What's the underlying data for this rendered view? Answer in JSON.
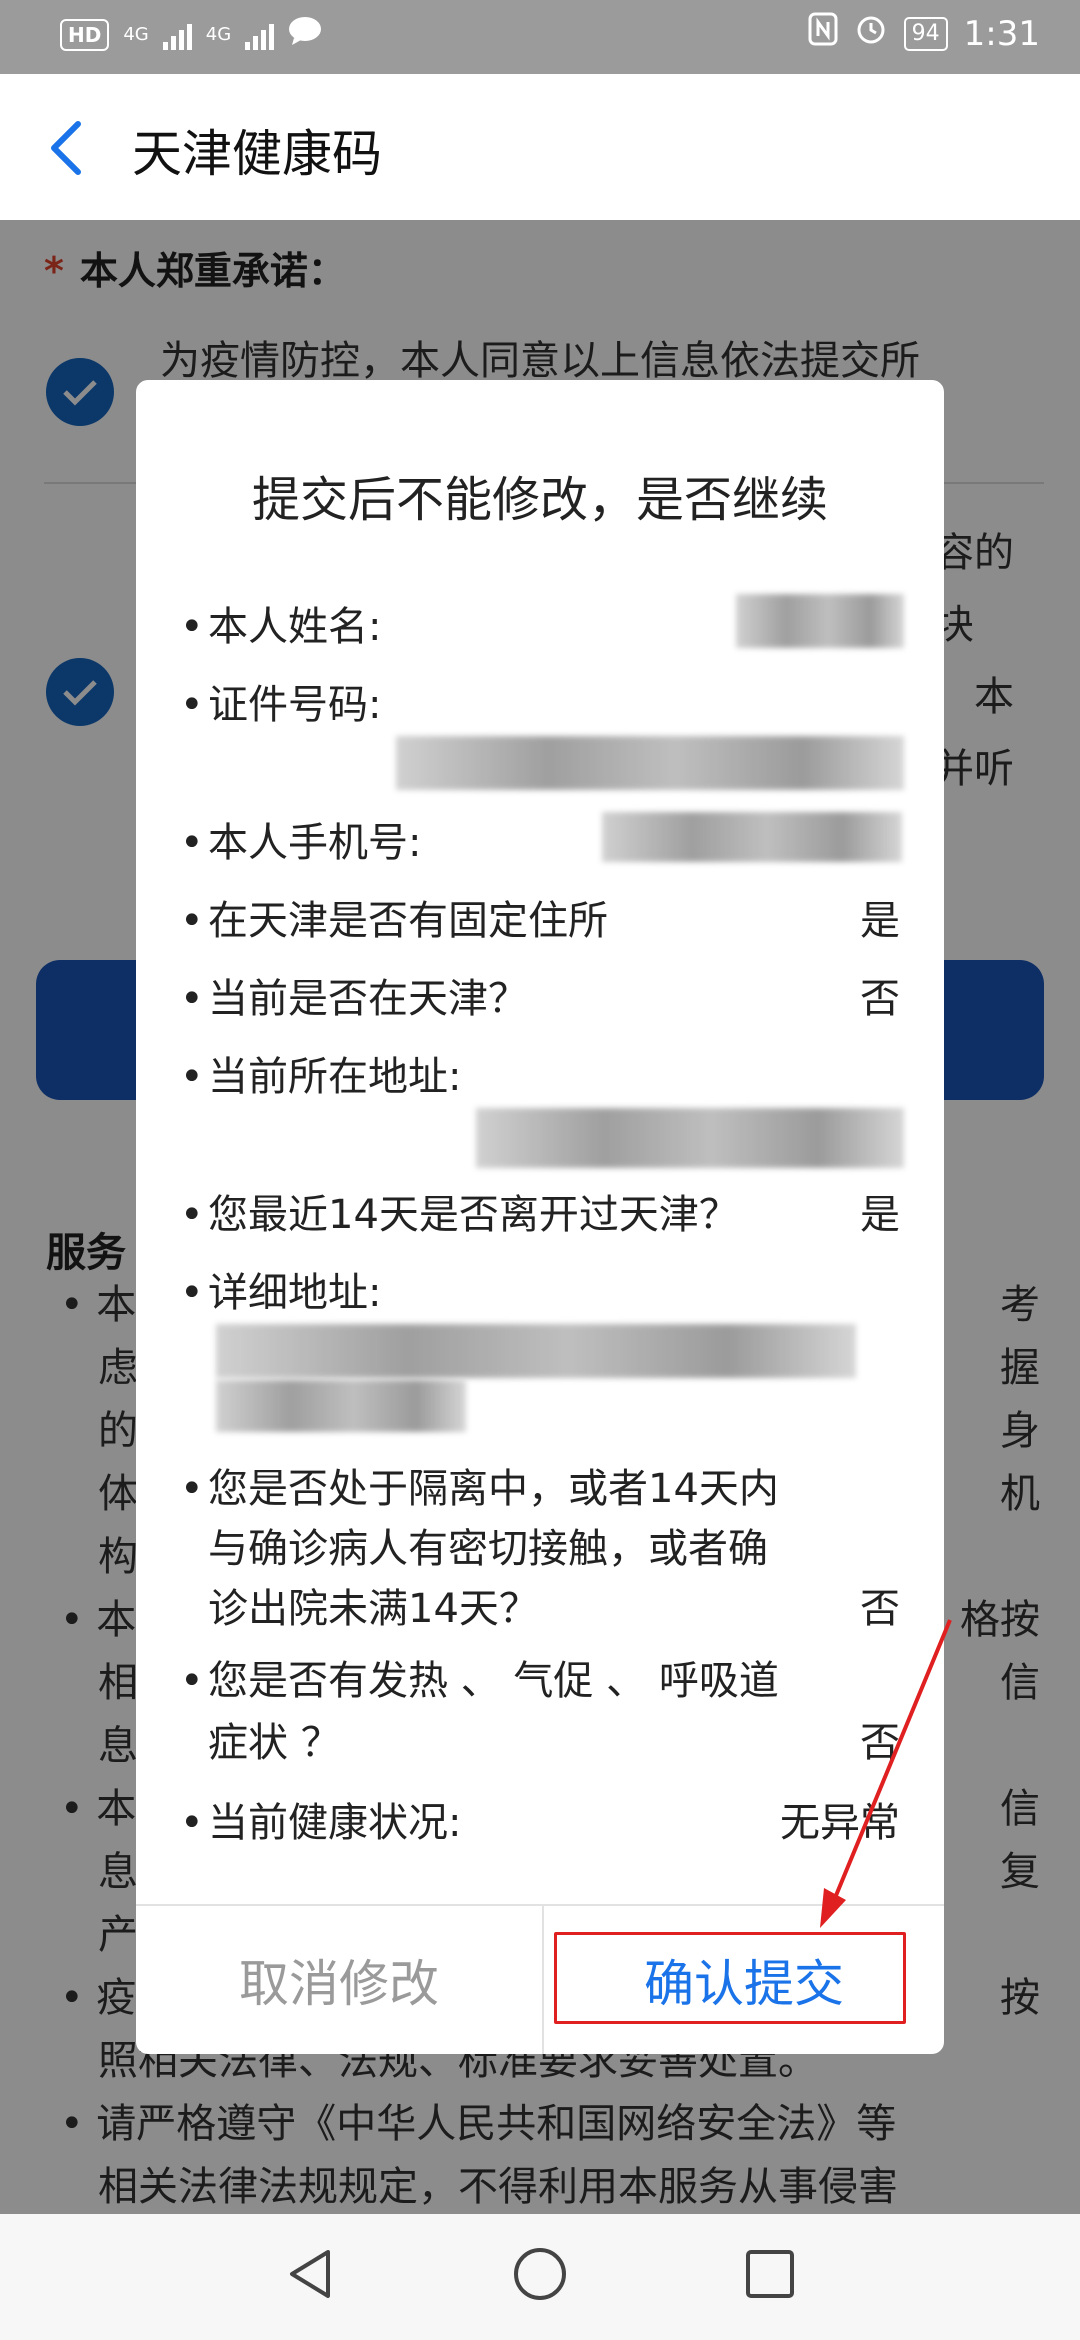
{
  "status_bar": {
    "hd": "HD",
    "sim1": "4G",
    "sim2": "4G",
    "battery": "94",
    "time": "1:31"
  },
  "app_bar": {
    "title": "天津健康码"
  },
  "background": {
    "promise_label": "本人郑重承诺：",
    "promise_text_1": "为疫情防控，本人同意以上信息依法提交所",
    "promise_text_2_frag_a": "容的",
    "promise_text_2_frag_b": "块",
    "promise_text_2_frag_c": "本",
    "promise_text_2_frag_d": "并听",
    "service_title": "服务",
    "service_lines": [
      {
        "left": "• 本",
        "right": "考"
      },
      {
        "left": "虑",
        "right": "握"
      },
      {
        "left": "的",
        "right": "身"
      },
      {
        "left": "体",
        "right": "机"
      },
      {
        "left": "构",
        "right": ""
      },
      {
        "left": "• 本",
        "right": "格按"
      },
      {
        "left": "相",
        "right": "信"
      },
      {
        "left": "息",
        "right": ""
      },
      {
        "left": "• 本",
        "right": "信"
      },
      {
        "left": "息",
        "right": "复"
      },
      {
        "left": "产",
        "right": ""
      },
      {
        "left": "• 疫",
        "right": "按"
      },
      {
        "left": "照相关法律、法规、标准要求妥善处置。",
        "right": ""
      },
      {
        "left": "• 请严格遵守《中华人民共和国网络安全法》等",
        "right": ""
      },
      {
        "left": "相关法律法规规定，不得利用本服务从事侵害",
        "right": ""
      }
    ]
  },
  "dialog": {
    "title": "提交后不能修改，是否继续",
    "bullet": "•",
    "name_label": "本人姓名:",
    "id_label": "证件号码:",
    "phone_label": "本人手机号:",
    "residence_label": "在天津是否有固定住所",
    "residence_value": "是",
    "in_tianjin_label": "当前是否在天津？",
    "in_tianjin_value": "否",
    "address_label": "当前所在地址:",
    "left_tianjin_label": "您最近14天是否离开过天津？",
    "left_tianjin_value": "是",
    "detail_address_label": "详细地址:",
    "isolation_line1": "您是否处于隔离中，或者14天内",
    "isolation_line2": "与确诊病人有密切接触，或者确",
    "isolation_line3": "诊出院未满14天？",
    "isolation_value": "否",
    "symptom_line1": "您是否有发热 、 气促 、 呼吸道",
    "symptom_line2": "症状 ？",
    "symptom_value": "否",
    "health_label": "当前健康状况:",
    "health_value": "无异常",
    "cancel_label": "取消修改",
    "confirm_label": "确认提交"
  },
  "colors": {
    "accent": "#1a73e8",
    "annotation": "#e02020"
  },
  "nav_bar": {
    "back_icon": "triangle-back-icon",
    "home_icon": "circle-home-icon",
    "recents_icon": "square-recents-icon"
  }
}
